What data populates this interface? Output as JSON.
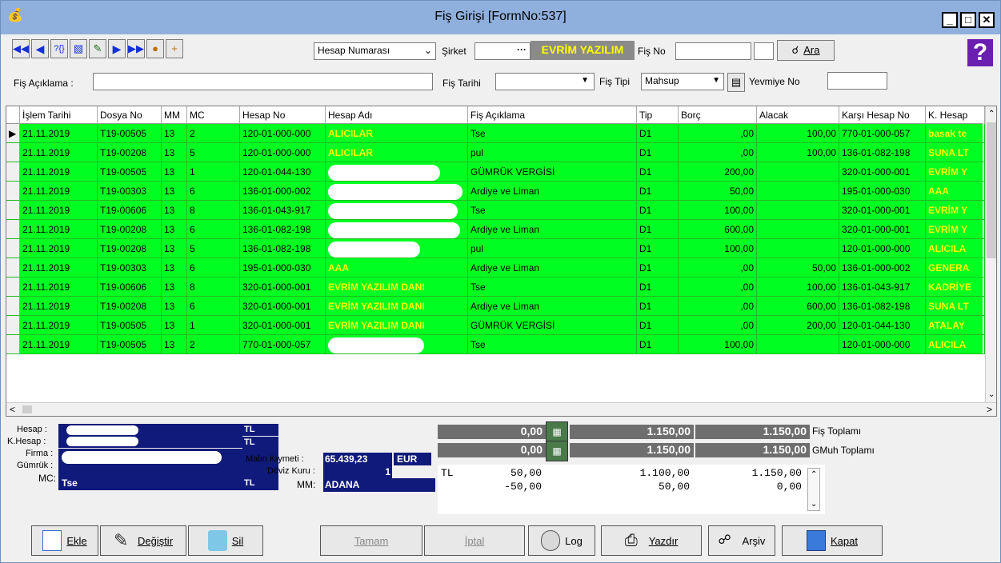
{
  "window": {
    "title": "Fiş Girişi [FormNo:537]",
    "help": "?"
  },
  "toolbar": {
    "select_value": "Hesap Numarası",
    "sirket_label": "Şirket",
    "sirket_value": "EVRİM YAZILIM",
    "fisno_label": "Fiş No",
    "ara_label": "Ara",
    "fis_aciklama_label": "Fiş Açıklama :",
    "fis_tarihi_label": "Fiş Tarihi",
    "fis_tipi_label": "Fiş Tipi",
    "fis_tipi_value": "Mahsup",
    "yevmiye_label": "Yevmiye No"
  },
  "columns": [
    "İşlem Tarihi",
    "Dosya No",
    "MM",
    "MC",
    "Hesap No",
    "Hesap Adı",
    "Fiş Açıklama",
    "Tip",
    "Borç",
    "Alacak",
    "Karşı Hesap No",
    "K. Hesap"
  ],
  "rows": [
    {
      "tarih": "21.11.2019",
      "dosya": "T19-00505",
      "mm": "13",
      "mc": "2",
      "hesap": "120-01-000-000",
      "adi": "ALICILAR",
      "aciklama": "Tse",
      "tip": "D1",
      "borc": ",00",
      "alacak": "100,00",
      "karsi": "770-01-000-057",
      "khesap": "basak te"
    },
    {
      "tarih": "21.11.2019",
      "dosya": "T19-00208",
      "mm": "13",
      "mc": "5",
      "hesap": "120-01-000-000",
      "adi": "ALICILAR",
      "aciklama": "pul",
      "tip": "D1",
      "borc": ",00",
      "alacak": "100,00",
      "karsi": "136-01-082-198",
      "khesap": "SUNA LT"
    },
    {
      "tarih": "21.11.2019",
      "dosya": "T19-00505",
      "mm": "13",
      "mc": "1",
      "hesap": "120-01-044-130",
      "adi": "",
      "aciklama": "GÜMRÜK VERGİSİ",
      "tip": "D1",
      "borc": "200,00",
      "alacak": "",
      "karsi": "320-01-000-001",
      "khesap": "EVRİM Y"
    },
    {
      "tarih": "21.11.2019",
      "dosya": "T19-00303",
      "mm": "13",
      "mc": "6",
      "hesap": "136-01-000-002",
      "adi": "",
      "aciklama": "Ardiye ve Liman",
      "tip": "D1",
      "borc": "50,00",
      "alacak": "",
      "karsi": "195-01-000-030",
      "khesap": "AAA"
    },
    {
      "tarih": "21.11.2019",
      "dosya": "T19-00606",
      "mm": "13",
      "mc": "8",
      "hesap": "136-01-043-917",
      "adi": "",
      "aciklama": "Tse",
      "tip": "D1",
      "borc": "100,00",
      "alacak": "",
      "karsi": "320-01-000-001",
      "khesap": "EVRİM Y"
    },
    {
      "tarih": "21.11.2019",
      "dosya": "T19-00208",
      "mm": "13",
      "mc": "6",
      "hesap": "136-01-082-198",
      "adi": "",
      "aciklama": "Ardiye ve Liman",
      "tip": "D1",
      "borc": "600,00",
      "alacak": "",
      "karsi": "320-01-000-001",
      "khesap": "EVRİM Y"
    },
    {
      "tarih": "21.11.2019",
      "dosya": "T19-00208",
      "mm": "13",
      "mc": "5",
      "hesap": "136-01-082-198",
      "adi": "",
      "aciklama": "pul",
      "tip": "D1",
      "borc": "100,00",
      "alacak": "",
      "karsi": "120-01-000-000",
      "khesap": "ALICILA"
    },
    {
      "tarih": "21.11.2019",
      "dosya": "T19-00303",
      "mm": "13",
      "mc": "6",
      "hesap": "195-01-000-030",
      "adi": "AAA",
      "aciklama": "Ardiye ve Liman",
      "tip": "D1",
      "borc": ",00",
      "alacak": "50,00",
      "karsi": "136-01-000-002",
      "khesap": "GENERA"
    },
    {
      "tarih": "21.11.2019",
      "dosya": "T19-00606",
      "mm": "13",
      "mc": "8",
      "hesap": "320-01-000-001",
      "adi": "EVRİM YAZILIM DANI",
      "aciklama": "Tse",
      "tip": "D1",
      "borc": ",00",
      "alacak": "100,00",
      "karsi": "136-01-043-917",
      "khesap": "KADRİYE"
    },
    {
      "tarih": "21.11.2019",
      "dosya": "T19-00208",
      "mm": "13",
      "mc": "6",
      "hesap": "320-01-000-001",
      "adi": "EVRİM YAZILIM DANI",
      "aciklama": "Ardiye ve Liman",
      "tip": "D1",
      "borc": ",00",
      "alacak": "600,00",
      "karsi": "136-01-082-198",
      "khesap": "SUNA LT"
    },
    {
      "tarih": "21.11.2019",
      "dosya": "T19-00505",
      "mm": "13",
      "mc": "1",
      "hesap": "320-01-000-001",
      "adi": "EVRİM YAZILIM DANI",
      "aciklama": "GÜMRÜK VERGİSİ",
      "tip": "D1",
      "borc": ",00",
      "alacak": "200,00",
      "karsi": "120-01-044-130",
      "khesap": "ATALAY"
    },
    {
      "tarih": "21.11.2019",
      "dosya": "T19-00505",
      "mm": "13",
      "mc": "2",
      "hesap": "770-01-000-057",
      "adi": "",
      "aciklama": "Tse",
      "tip": "D1",
      "borc": "100,00",
      "alacak": "",
      "karsi": "120-01-000-000",
      "khesap": "ALICILA"
    }
  ],
  "info": {
    "hesap_label": "Hesap :",
    "khesap_label": "K.Hesap :",
    "firma_label": "Firma :",
    "gumruk_label": "Gümrük :",
    "mc_label": "MC:",
    "mc_value": "Tse",
    "currency1": "TL",
    "currency2": "TL",
    "currency3": "TL",
    "malin_label": "Malın Kıymeti :",
    "malin_value": "65.439,23",
    "malin_cur": "EUR",
    "doviz_label": "Döviz Kuru :",
    "doviz_value": "1",
    "mm_label": "MM:",
    "mm_value": "ADANA"
  },
  "totals": {
    "fis_a": "0,00",
    "fis_b": "1.150,00",
    "fis_c": "1.150,00",
    "fis_label": "Fiş Toplamı",
    "gmuh_a": "0,00",
    "gmuh_b": "1.150,00",
    "gmuh_c": "1.150,00",
    "gmuh_label": "GMuh Toplamı",
    "l1_cur": "TL",
    "l1_a": "50,00",
    "l1_b": "1.100,00",
    "l1_c": "1.150,00",
    "l2_a": "-50,00",
    "l2_b": "50,00",
    "l2_c": "0,00"
  },
  "buttons": {
    "ekle": "Ekle",
    "degistir": "Değiştir",
    "sil": "Sil",
    "tamam": "Tamam",
    "iptal": "İptal",
    "log": "Log",
    "yazdir": "Yazdır",
    "arsiv": "Arşiv",
    "kapat": "Kapat"
  },
  "colors": {
    "row_green": "#00ff21",
    "navy": "#101a7a",
    "accent_yellow": "#ffff00"
  }
}
